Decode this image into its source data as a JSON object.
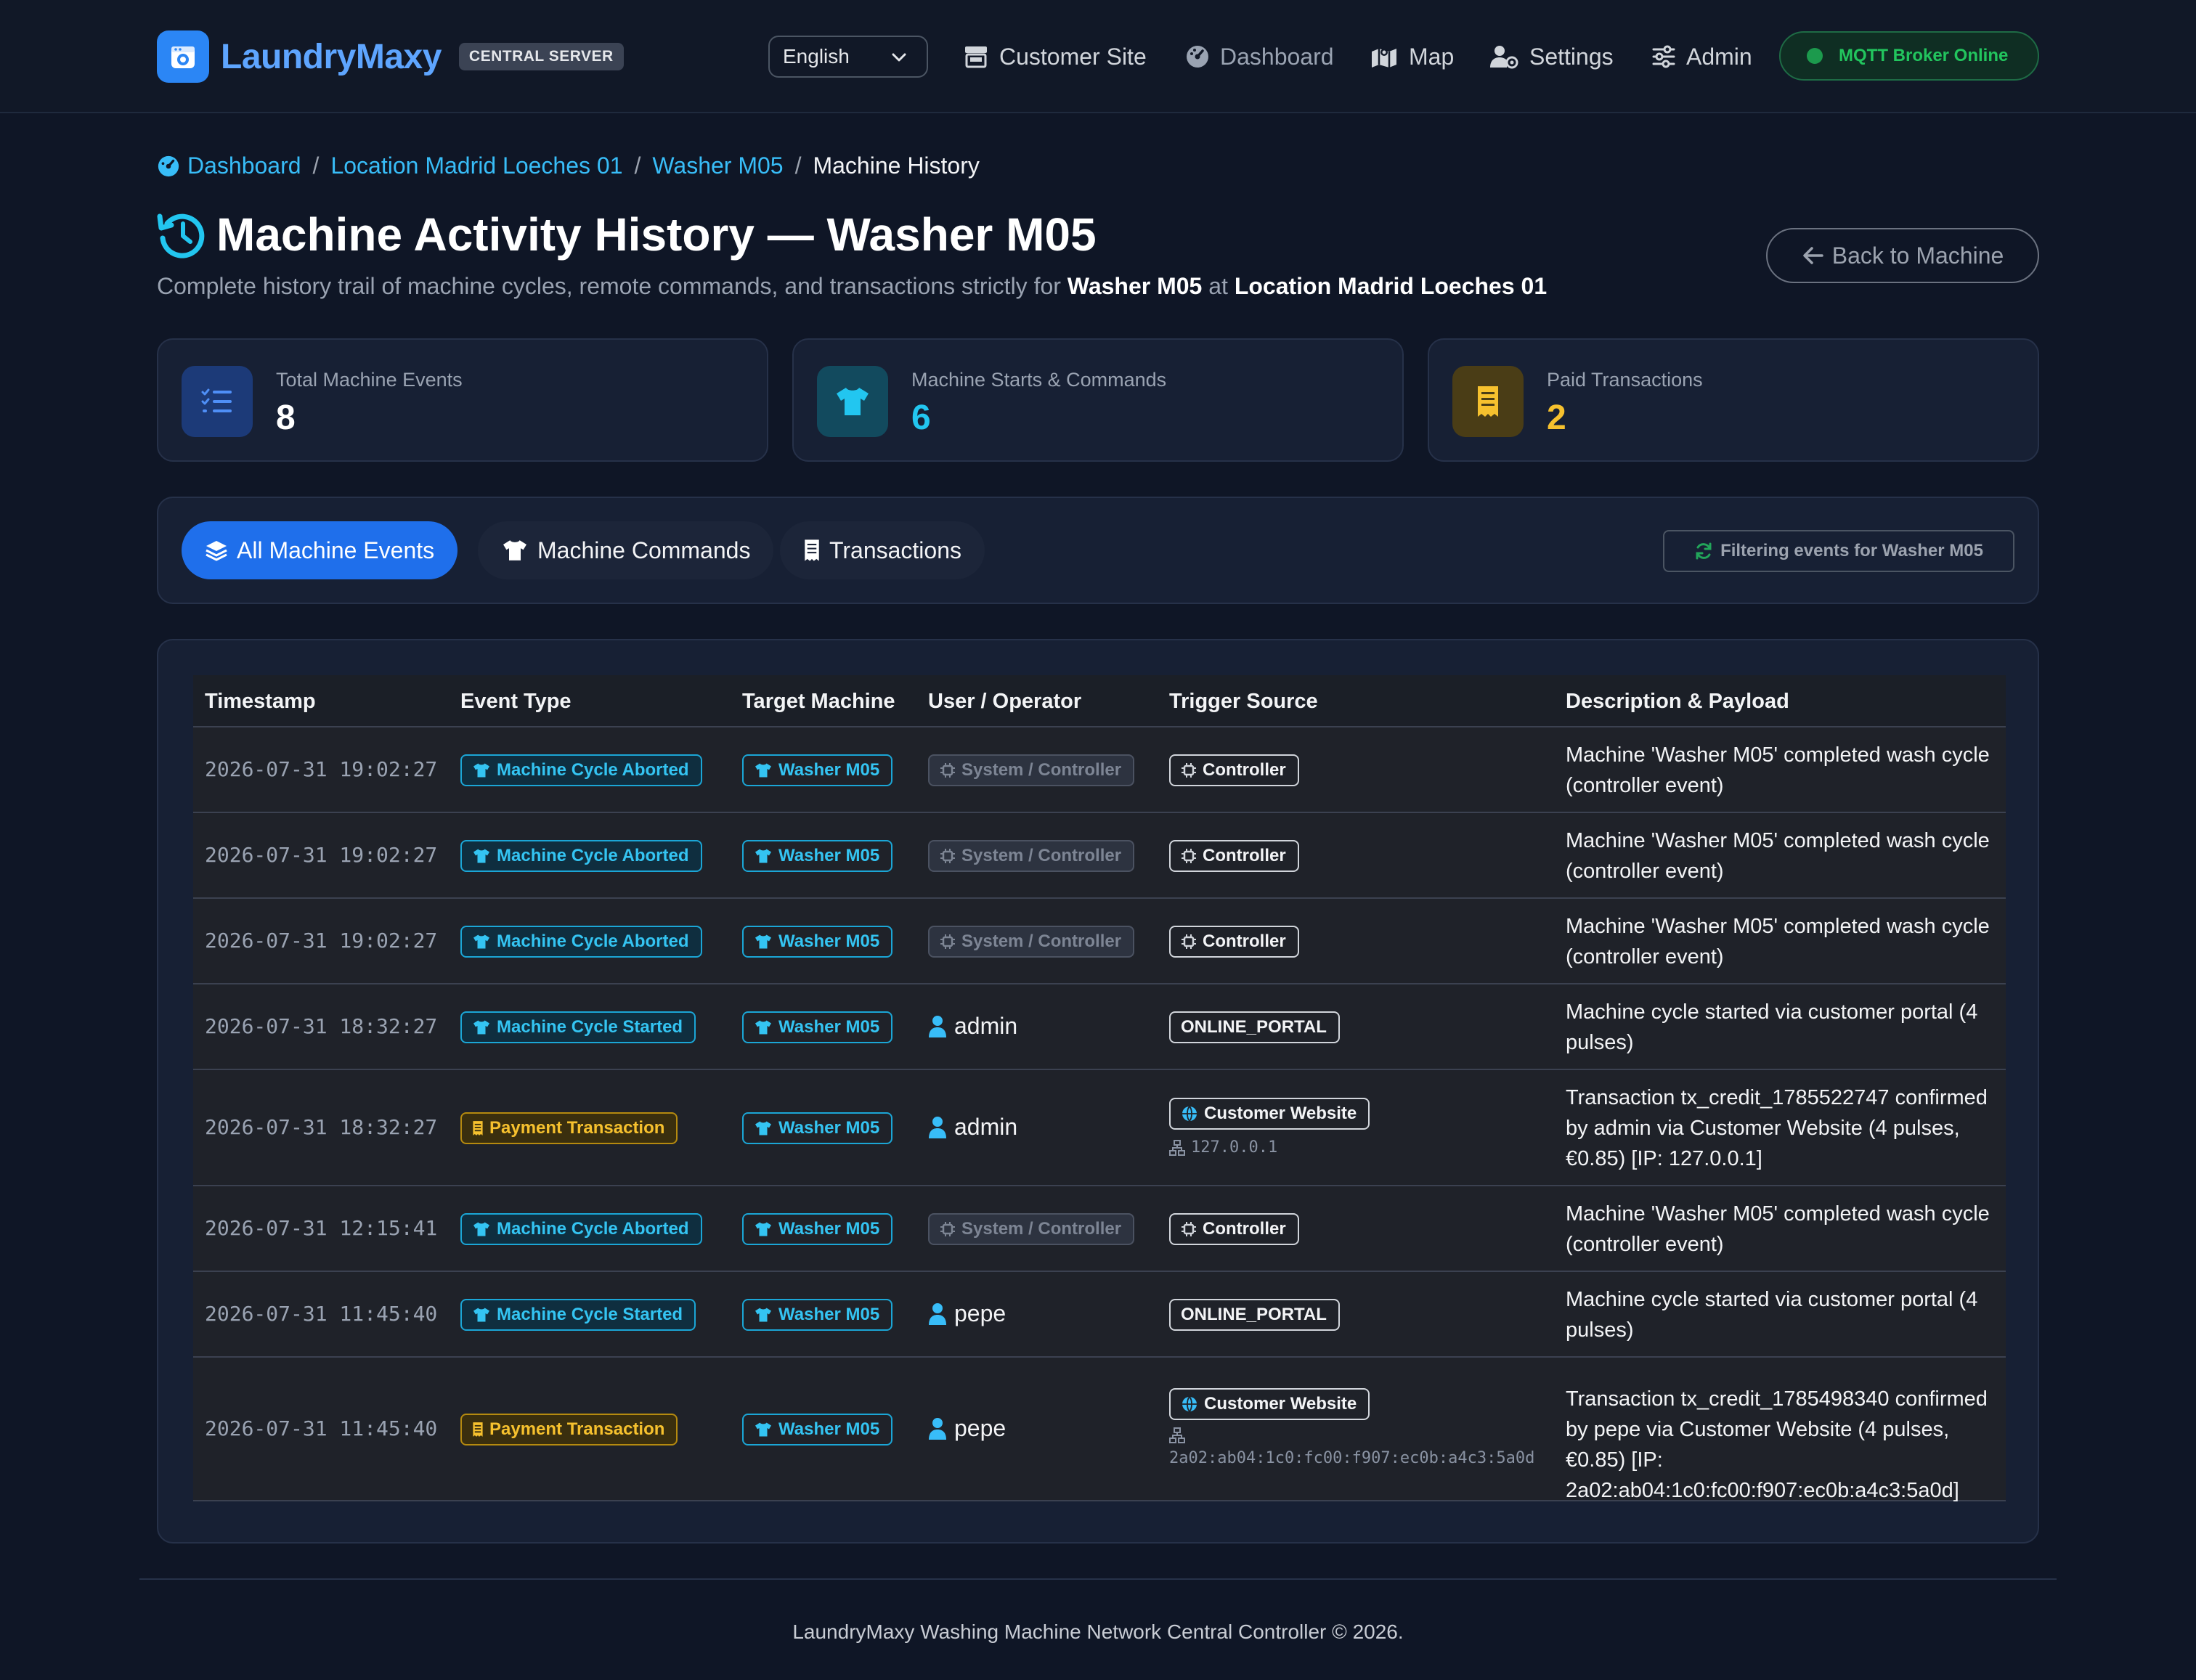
{
  "brand": {
    "name": "LaundryMaxy",
    "badge": "CENTRAL SERVER"
  },
  "nav": {
    "language": "English",
    "items": [
      {
        "label": "Customer Site",
        "icon": "store-icon"
      },
      {
        "label": "Dashboard",
        "icon": "gauge-icon"
      },
      {
        "label": "Map",
        "icon": "map-icon"
      },
      {
        "label": "Settings",
        "icon": "user-gear-icon"
      },
      {
        "label": "Admin",
        "icon": "sliders-icon"
      }
    ],
    "mqtt_status": "MQTT Broker Online"
  },
  "breadcrumb": [
    "Dashboard",
    "Location Madrid Loeches 01",
    "Washer M05",
    "Machine History"
  ],
  "header": {
    "title": "Machine Activity History — Washer M05",
    "subtitle_prefix": "Complete history trail of machine cycles, remote commands, and transactions strictly for",
    "subtitle_machine": "Washer M05",
    "subtitle_at": "at",
    "subtitle_location": "Location Madrid Loeches 01",
    "back_button": "Back to Machine"
  },
  "stats": [
    {
      "label": "Total Machine Events",
      "value": "8",
      "color": "#ffffff"
    },
    {
      "label": "Machine Starts & Commands",
      "value": "6",
      "color": "#22c6f0"
    },
    {
      "label": "Paid Transactions",
      "value": "2",
      "color": "#f6c12e"
    }
  ],
  "tabs": {
    "items": [
      "All Machine Events",
      "Machine Commands",
      "Transactions"
    ],
    "active": "All Machine Events",
    "filter_badge": "Filtering events for Washer M05"
  },
  "table": {
    "columns": [
      "Timestamp",
      "Event Type",
      "Target Machine",
      "User / Operator",
      "Trigger Source",
      "Description & Payload"
    ],
    "rows": [
      {
        "timestamp": "2026-07-31 19:02:27",
        "event": "Machine Cycle Aborted",
        "machine": "Washer M05",
        "user": "System / Controller",
        "source": "Controller",
        "ip": "",
        "description": "Machine 'Washer M05' completed wash cycle (controller event)"
      },
      {
        "timestamp": "2026-07-31 19:02:27",
        "event": "Machine Cycle Aborted",
        "machine": "Washer M05",
        "user": "System / Controller",
        "source": "Controller",
        "ip": "",
        "description": "Machine 'Washer M05' completed wash cycle (controller event)"
      },
      {
        "timestamp": "2026-07-31 19:02:27",
        "event": "Machine Cycle Aborted",
        "machine": "Washer M05",
        "user": "System / Controller",
        "source": "Controller",
        "ip": "",
        "description": "Machine 'Washer M05' completed wash cycle (controller event)"
      },
      {
        "timestamp": "2026-07-31 18:32:27",
        "event": "Machine Cycle Started",
        "machine": "Washer M05",
        "user": "admin",
        "source": "ONLINE_PORTAL",
        "ip": "",
        "description": "Machine cycle started via customer portal (4 pulses)"
      },
      {
        "timestamp": "2026-07-31 18:32:27",
        "event": "Payment Transaction",
        "machine": "Washer M05",
        "user": "admin",
        "source": "Customer Website",
        "ip": "127.0.0.1",
        "description": "Transaction tx_credit_1785522747 confirmed by admin via Customer Website (4 pulses, €0.85) [IP: 127.0.0.1]"
      },
      {
        "timestamp": "2026-07-31 12:15:41",
        "event": "Machine Cycle Aborted",
        "machine": "Washer M05",
        "user": "System / Controller",
        "source": "Controller",
        "ip": "",
        "description": "Machine 'Washer M05' completed wash cycle (controller event)"
      },
      {
        "timestamp": "2026-07-31 11:45:40",
        "event": "Machine Cycle Started",
        "machine": "Washer M05",
        "user": "pepe",
        "source": "ONLINE_PORTAL",
        "ip": "",
        "description": "Machine cycle started via customer portal (4 pulses)"
      },
      {
        "timestamp": "2026-07-31 11:45:40",
        "event": "Payment Transaction",
        "machine": "Washer M05",
        "user": "pepe",
        "source": "Customer Website",
        "ip": "2a02:ab04:1c0:fc00:f907:ec0b:a4c3:5a0d",
        "description": "Transaction tx_credit_1785498340 confirmed by pepe via Customer Website (4 pulses, €0.85) [IP: 2a02:ab04:1c0:fc00:f907:ec0b:a4c3:5a0d]"
      }
    ]
  },
  "footer": "LaundryMaxy Washing Machine Network Central Controller © 2026."
}
